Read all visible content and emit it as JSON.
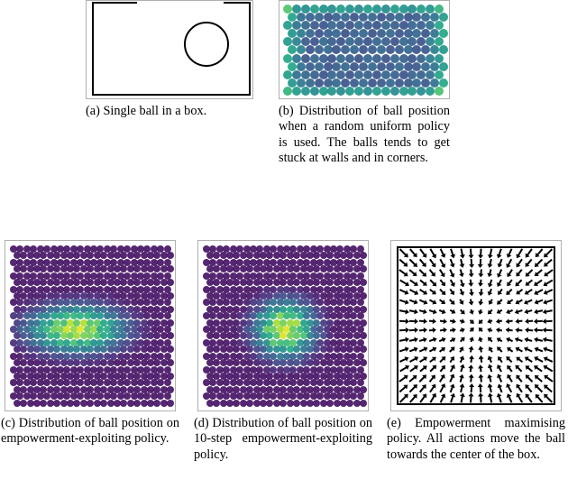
{
  "captions": {
    "a": "(a) Single ball in a box.",
    "b": "(b) Distribution of ball position when a random uniform policy is used. The balls tends to get stuck at walls and in corners.",
    "c": "(c) Distribution of ball position on empowerment-exploiting policy.",
    "d": "(d) Distribution of ball position on 10-step empowerment-exploiting policy.",
    "e": "(e) Empowerment maximising policy.    All actions move the ball towards the center of the box."
  },
  "colors": {
    "viridis": [
      "#440154",
      "#482475",
      "#414487",
      "#355f8d",
      "#2a788e",
      "#21918c",
      "#22a884",
      "#44bf70",
      "#7ad151",
      "#bddf26",
      "#fde725"
    ]
  },
  "chart_data": [
    {
      "id": "a",
      "type": "diagram",
      "title": "Single ball in a box",
      "description": "A square box outline (top edge partially open) with one circle near the right side representing a ball."
    },
    {
      "id": "b",
      "type": "heatmap",
      "title": "Ball position distribution under random uniform policy",
      "grid": "hex",
      "grid_shape": [
        18,
        11
      ],
      "colorscale": "viridis",
      "value_range": [
        0,
        1
      ],
      "pattern": "High density along all four edges and especially the four corners; low density in the interior.",
      "corner_value": 1.0,
      "edge_value": 0.6,
      "interior_value": 0.25
    },
    {
      "id": "c",
      "type": "heatmap",
      "title": "Ball position distribution on empowerment-exploiting policy",
      "grid": "hex",
      "grid_shape": [
        24,
        24
      ],
      "colorscale": "viridis",
      "value_range": [
        0,
        1
      ],
      "pattern": "Density concentrated in a horizontal blob slightly left of center; near-zero at boundaries.",
      "center": [
        0.4,
        0.52
      ],
      "blob_extent": [
        0.45,
        0.22
      ],
      "peak_value": 0.95,
      "background_value": 0.05
    },
    {
      "id": "d",
      "type": "heatmap",
      "title": "Ball position distribution on 10-step empowerment-exploiting policy",
      "grid": "hex",
      "grid_shape": [
        24,
        24
      ],
      "colorscale": "viridis",
      "value_range": [
        0,
        1
      ],
      "pattern": "Density concentrated in a compact blob near the center; near-zero at boundaries.",
      "center": [
        0.5,
        0.52
      ],
      "blob_extent": [
        0.3,
        0.28
      ],
      "peak_value": 0.95,
      "background_value": 0.05
    },
    {
      "id": "e",
      "type": "vector-field",
      "title": "Empowerment-maximising policy",
      "grid_shape": [
        16,
        16
      ],
      "direction": "towards-center",
      "center": [
        0.5,
        0.5
      ],
      "magnitude": "proportional to distance from center",
      "description": "At each grid location the action (arrow) points toward the box center; arrow length grows with distance from center and vanishes at the center."
    }
  ]
}
